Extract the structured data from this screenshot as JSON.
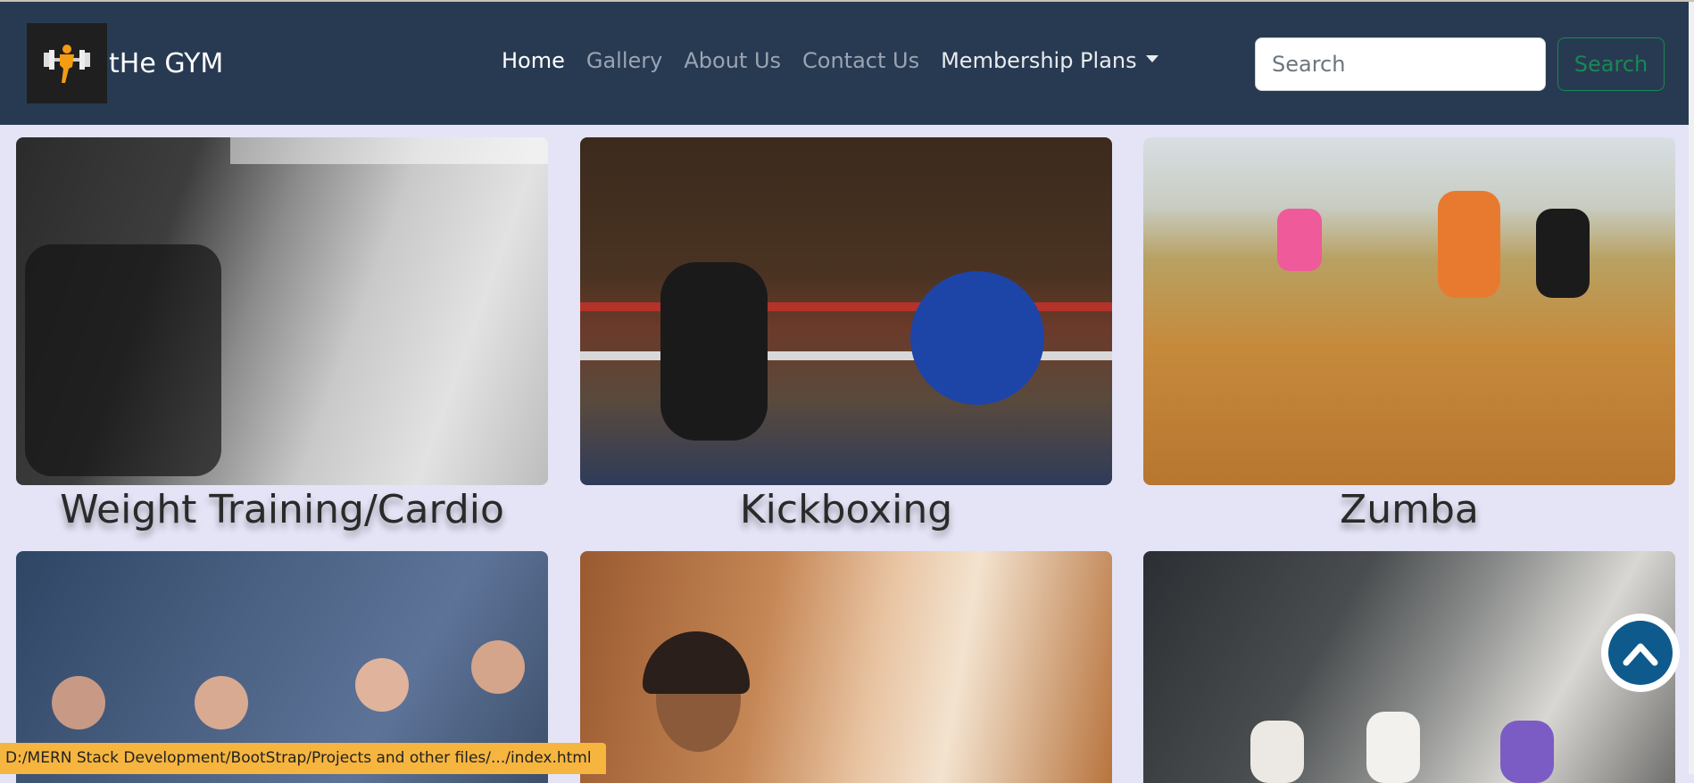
{
  "nav": {
    "brand": "tHe GYM",
    "links": [
      {
        "label": "Home"
      },
      {
        "label": "Gallery"
      },
      {
        "label": "About Us"
      },
      {
        "label": "Contact Us"
      },
      {
        "label": "Membership Plans"
      }
    ],
    "search": {
      "placeholder": "Search",
      "button": "Search"
    }
  },
  "gallery": {
    "cards": [
      {
        "caption": "Weight Training/Cardio"
      },
      {
        "caption": "Kickboxing"
      },
      {
        "caption": "Zumba"
      },
      {
        "caption": ""
      },
      {
        "caption": ""
      },
      {
        "caption": ""
      }
    ]
  },
  "status_bar": "D:/MERN Stack Development/BootStrap/Projects and other files/.../index.html",
  "colors": {
    "navbar": "#283a52",
    "page_bg": "#e4e4f6",
    "search_button": "#198754",
    "scroll_button": "#0f5a8c"
  },
  "icons": {
    "logo": "gym-dumbbell-logo-icon",
    "scroll_top": "chevron-up-icon",
    "dropdown": "caret-down-icon"
  }
}
